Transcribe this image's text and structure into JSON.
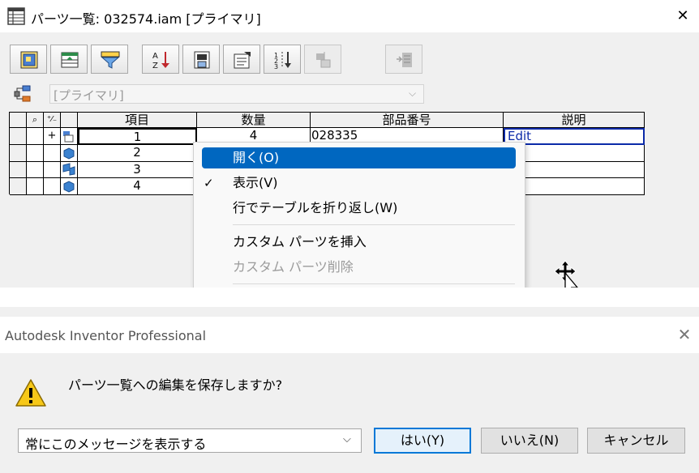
{
  "bom_window": {
    "title": "パーツ一覧: 032574.iam [プライマリ]",
    "close_glyph": "✕",
    "toolbar": [
      {
        "icon": "product-view-icon",
        "enabled": true
      },
      {
        "icon": "structured-view-icon",
        "enabled": true
      },
      {
        "icon": "filter-icon",
        "enabled": true
      },
      {
        "icon": "sort-icon",
        "enabled": true
      },
      {
        "icon": "export-icon",
        "enabled": true
      },
      {
        "icon": "properties-icon",
        "enabled": true
      },
      {
        "icon": "renumber-icon",
        "enabled": true
      },
      {
        "icon": "parts-list-icon",
        "enabled": false
      },
      {
        "icon": "export-bom-icon",
        "enabled": false
      }
    ],
    "view_select": {
      "value": "[プライマリ]",
      "enabled": false
    },
    "grid": {
      "headers": [
        "項目",
        "数量",
        "部品番号",
        "説明"
      ],
      "rows": [
        {
          "item": "1",
          "qty": "4",
          "part_number": "028335",
          "description": "Edit",
          "expand": "+"
        },
        {
          "item": "2"
        },
        {
          "item": "3"
        },
        {
          "item": "4"
        }
      ]
    },
    "context_menu": [
      {
        "label": "開く(O)",
        "highlighted": true
      },
      {
        "label": "表示(V)",
        "checked": true
      },
      {
        "label": "行でテーブルを折り返し(W)"
      },
      {
        "label": "カスタム パーツを挿入"
      },
      {
        "label": "カスタム パーツ削除",
        "disabled": true
      }
    ]
  },
  "dialog": {
    "title": "Autodesk Inventor Professional",
    "close_glyph": "✕",
    "message": "パーツ一覧への編集を保存しますか?",
    "dont_show_select": "常にこのメッセージを表示する",
    "buttons": {
      "yes": "はい(Y)",
      "no": "いいえ(N)",
      "cancel": "キャンセル"
    }
  },
  "colors": {
    "accent": "#0067c0",
    "focus_border": "#0078d7"
  }
}
